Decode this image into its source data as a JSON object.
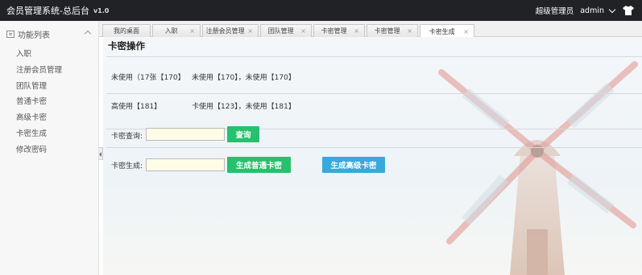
{
  "header": {
    "title": "会员管理系统-总后台",
    "version": "v1.0",
    "role": "超级管理员",
    "username": "admin",
    "icons": [
      "chevron-down-icon",
      "shirt-icon"
    ]
  },
  "sidebar": {
    "heading": "功能列表",
    "items": [
      {
        "label": "入职"
      },
      {
        "label": "注册会员管理"
      },
      {
        "label": "团队管理"
      },
      {
        "label": "普通卡密"
      },
      {
        "label": "高级卡密"
      },
      {
        "label": "卡密生成"
      },
      {
        "label": "修改密码"
      }
    ]
  },
  "tabs": [
    {
      "label": "我的桌面",
      "closable": false
    },
    {
      "label": "入职",
      "closable": true
    },
    {
      "label": "注册会员管理",
      "closable": true
    },
    {
      "label": "团队管理",
      "closable": true
    },
    {
      "label": "卡密管理",
      "closable": true
    },
    {
      "label": "卡密管理",
      "closable": true
    },
    {
      "label": "卡密生成",
      "closable": true,
      "active": true
    }
  ],
  "tab_close_glyph": "×",
  "panel": {
    "title": "卡密操作",
    "row1": {
      "left": "未使用（17张【170】",
      "right": "未使用【170】，未使用【170】"
    },
    "row2": {
      "left": "高使用【181】",
      "right": "卡使用【123】，未使用【181】"
    },
    "query": {
      "label": "卡密查询:",
      "input_value": "",
      "button": "查询"
    },
    "generate": {
      "label": "卡密生成:",
      "input_value": "",
      "normal_button": "生成普通卡密",
      "advanced_button": "生成高级卡密"
    }
  },
  "colors": {
    "topbar": "#202226",
    "green_button": "#27c06c",
    "blue_button": "#36a9dd",
    "input_bg": "#fdfde7"
  }
}
